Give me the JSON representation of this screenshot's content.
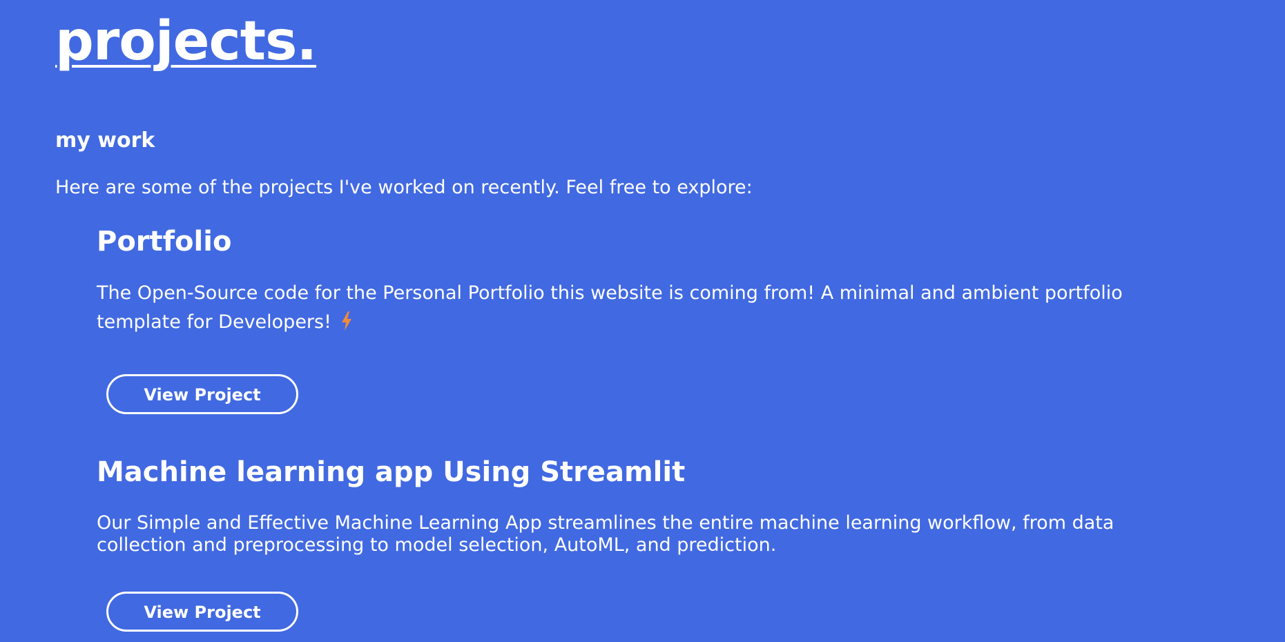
{
  "page": {
    "title": "projects.",
    "section_heading": "my work",
    "intro": "Here are some of the projects I've worked on recently. Feel free to explore:"
  },
  "projects": [
    {
      "title": "Portfolio",
      "description": "The Open-Source code for the Personal Portfolio this website is coming from! A minimal and ambient portfolio template for Developers!",
      "icon": "lightning-bolt-icon",
      "button_label": "View Project"
    },
    {
      "title": "Machine learning app Using Streamlit",
      "description": "Our Simple and Effective Machine Learning App streamlines the entire machine learning workflow, from data collection and preprocessing to model selection, AutoML, and prediction.",
      "button_label": "View Project"
    }
  ],
  "colors": {
    "background": "#4169e1",
    "text": "#ffffff",
    "accent": "#f08a3c"
  }
}
